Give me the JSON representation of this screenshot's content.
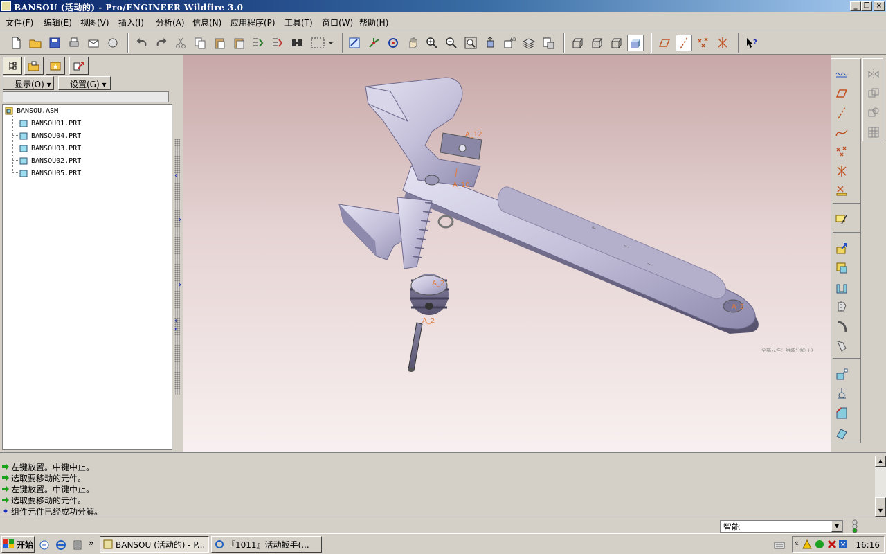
{
  "window": {
    "title": "BANSOU (活动的) - Pro/ENGINEER Wildfire 3.0",
    "minimize": "_",
    "restore": "❐",
    "close": "×"
  },
  "menu": [
    "文件(F)",
    "编辑(E)",
    "视图(V)",
    "插入(I)",
    "分析(A)",
    "信息(N)",
    "应用程序(P)",
    "工具(T)",
    "窗口(W)",
    "帮助(H)"
  ],
  "model_tree": {
    "show_label": "显示(O)",
    "settings_label": "设置(G)",
    "root": "BANSOU.ASM",
    "parts": [
      "BANSOU01.PRT",
      "BANSOU04.PRT",
      "BANSOU03.PRT",
      "BANSOU02.PRT",
      "BANSOU05.PRT"
    ]
  },
  "viewport": {
    "axis_labels": [
      "A_12",
      "A_10",
      "A_2",
      "A_2",
      "A_3"
    ],
    "spin_center_note": "全部元件：组装分解(+)"
  },
  "messages": [
    {
      "text": "左键放置。中键中止。",
      "type": "prompt"
    },
    {
      "text": "选取要移动的元件。",
      "type": "prompt"
    },
    {
      "text": "左键放置。中键中止。",
      "type": "prompt"
    },
    {
      "text": "选取要移动的元件。",
      "type": "prompt"
    },
    {
      "text": "组件元件已经成功分解。",
      "type": "info"
    }
  ],
  "status": {
    "filter_value": "智能"
  },
  "taskbar": {
    "start_label": "开始",
    "overflow": "»",
    "tasks": [
      "BANSOU (活动的) - P...",
      "『1011』活动扳手(..."
    ],
    "clock": "16:16"
  },
  "colors": {
    "title_start": "#0a246a",
    "title_end": "#a6caf0",
    "prompt_arrow": "#1aa31a",
    "info_bullet": "#1a2fb8",
    "model_fill": "#c4c0da",
    "axis_label": "#e07a3a"
  }
}
